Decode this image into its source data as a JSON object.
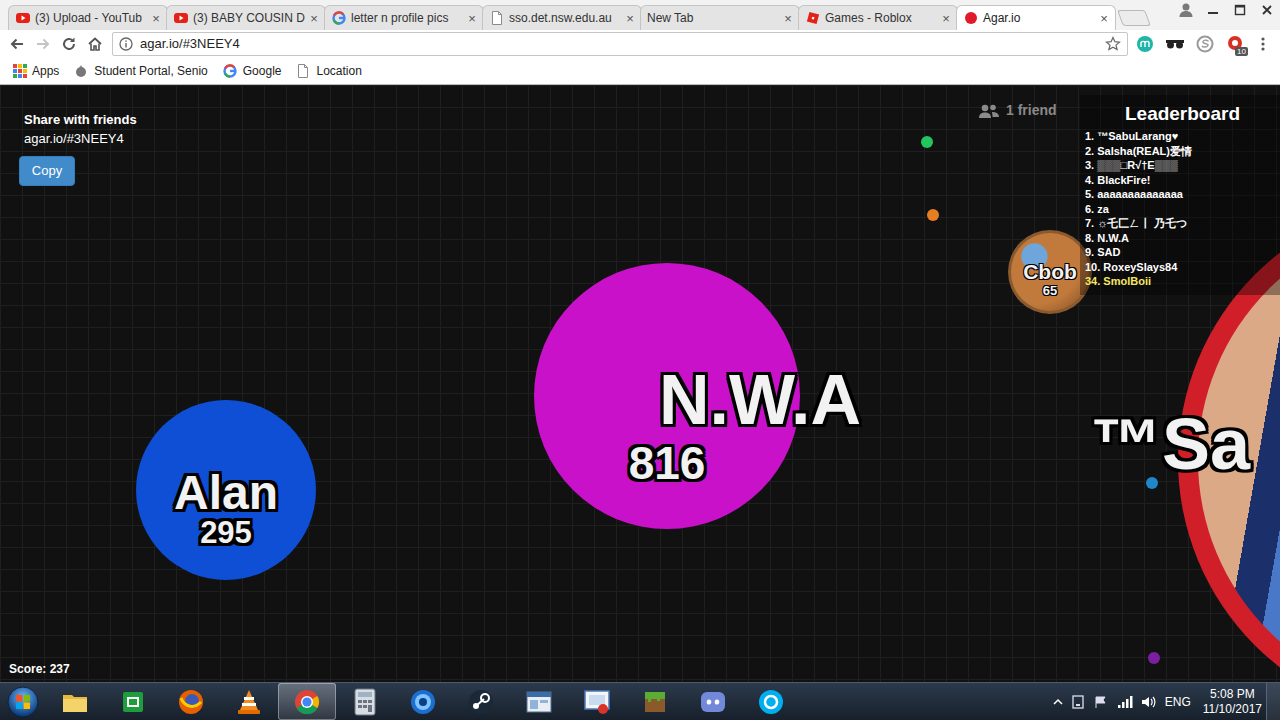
{
  "browser": {
    "tabs": [
      {
        "label": "(3) Upload - YouTub",
        "close": "×",
        "selected": false
      },
      {
        "label": "(3) BABY COUSIN D",
        "close": "×",
        "selected": false
      },
      {
        "label": "letter n profile pics",
        "close": "×",
        "selected": false
      },
      {
        "label": "sso.det.nsw.edu.au",
        "close": "×",
        "selected": false
      },
      {
        "label": "New Tab",
        "close": "×",
        "selected": false
      },
      {
        "label": "Games - Roblox",
        "close": "×",
        "selected": false
      },
      {
        "label": "Agar.io",
        "close": "×",
        "selected": true
      }
    ],
    "forward_disabled": true,
    "address": "agar.io/#3NEEY4",
    "extension_badge": "10",
    "bookmarks": [
      {
        "label": "Apps"
      },
      {
        "label": "Student Portal, Senio"
      },
      {
        "label": "Google"
      },
      {
        "label": "Location"
      }
    ]
  },
  "game": {
    "share": {
      "title": "Share with friends",
      "link": "agar.io/#3NEEY4",
      "button": "Copy"
    },
    "friends": "1 friend",
    "leaderboard": {
      "title": "Leaderboard",
      "entries": [
        {
          "text": "1. ™SabuLarang♥",
          "self": false
        },
        {
          "text": "2. Salsha(REAL)爱情",
          "self": false
        },
        {
          "text": "3. ▒▒▒□R√†E▒▒▒",
          "self": false
        },
        {
          "text": "4. BlackFire!",
          "self": false
        },
        {
          "text": "5. aaaaaaaaaaaaaa",
          "self": false
        },
        {
          "text": "6. za",
          "self": false
        },
        {
          "text": "7. ☼乇匚ㄥ丨 乃乇つ",
          "self": false
        },
        {
          "text": "8. N.W.A",
          "self": false
        },
        {
          "text": "9. SAD",
          "self": false
        },
        {
          "text": "10. RoxeySlays84",
          "self": false
        },
        {
          "text": "34. SmolBoii",
          "self": true
        }
      ]
    },
    "cells": [
      {
        "name": "Alan",
        "mass": "295",
        "color": "#0e4fd6",
        "kind": "plain"
      },
      {
        "name": "N.W.A",
        "mass": "816",
        "color": "#c811c8",
        "kind": "plain"
      },
      {
        "name": "Cbob",
        "mass": "65",
        "color": "#8a5a2e",
        "kind": "skin"
      },
      {
        "name": "™Sa",
        "color": "#d11f2a",
        "kind": "skin"
      }
    ],
    "pellets": [
      {
        "color": "#22c55e"
      },
      {
        "color": "#e67e22"
      },
      {
        "color": "#1e88c8"
      },
      {
        "color": "#7b1fa2"
      }
    ],
    "score": "Score: 237"
  },
  "taskbar": {
    "apps": [
      {
        "selected": false
      },
      {
        "selected": false
      },
      {
        "selected": false
      },
      {
        "selected": false
      },
      {
        "selected": true
      },
      {
        "selected": false
      },
      {
        "selected": false
      },
      {
        "selected": false
      },
      {
        "selected": false
      },
      {
        "selected": false
      },
      {
        "selected": false
      },
      {
        "selected": false
      },
      {
        "selected": false
      }
    ],
    "language": "ENG",
    "time": "5:08 PM",
    "date": "11/10/2017"
  }
}
